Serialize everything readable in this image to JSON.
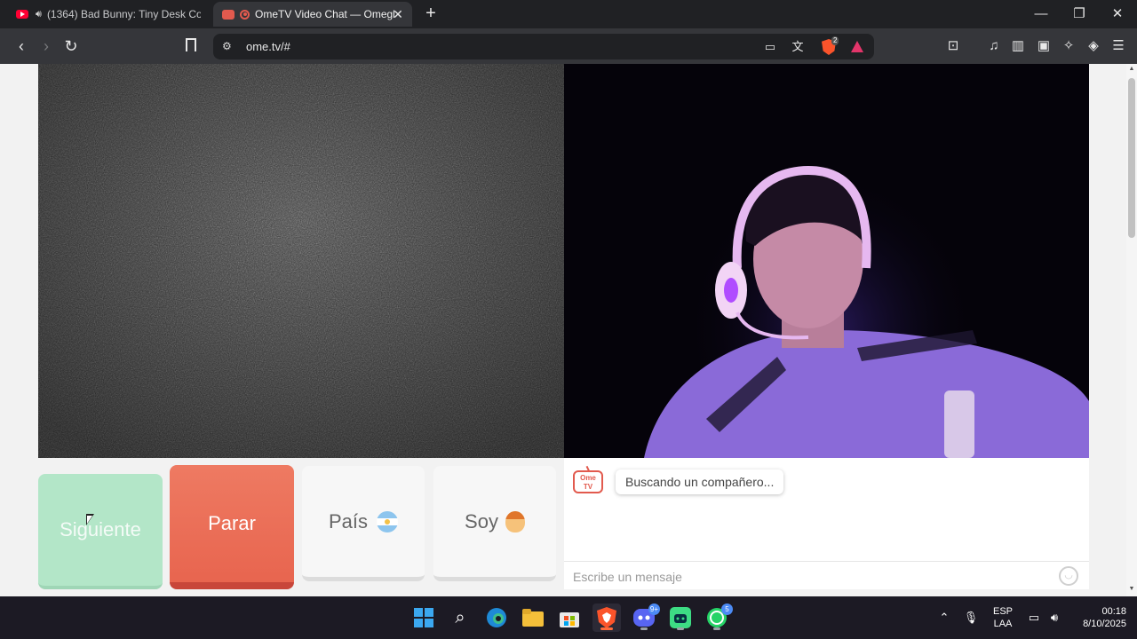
{
  "browser": {
    "tabs": [
      {
        "title": "(1364) Bad Bunny: Tiny Desk Con",
        "active": false,
        "favicon": "youtube-icon",
        "audio": true
      },
      {
        "title": "OmeTV Video Chat — Omegl",
        "active": true,
        "favicon": "ometv-icon",
        "recording": true
      }
    ],
    "new_tab_label": "+",
    "url": "ome.tv/#",
    "shield_count": "2"
  },
  "page": {
    "buttons": {
      "next_label": "Siguiente",
      "stop_label": "Parar",
      "country_label": "País",
      "gender_label": "Soy"
    },
    "chat": {
      "logo_text": "Ome TV",
      "status_message": "Buscando un compañero...",
      "input_placeholder": "Escribe un mensaje"
    },
    "colors": {
      "next": "#b3e6c8",
      "stop": "#e8654f",
      "brand": "#e25a4e"
    }
  },
  "taskbar": {
    "apps": [
      "windows-start",
      "search",
      "edge",
      "file-explorer",
      "microsoft-store",
      "brave",
      "discord",
      "android-studio",
      "whatsapp"
    ],
    "discord_badge": "9+",
    "whatsapp_badge": "5",
    "language_line1": "ESP",
    "language_line2": "LAA",
    "time": "00:18",
    "date": "8/10/2025"
  }
}
